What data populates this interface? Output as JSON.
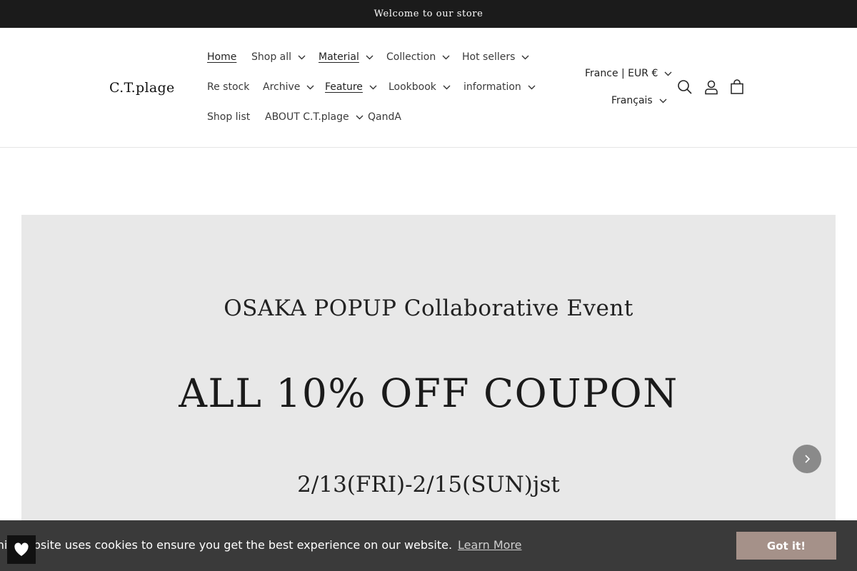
{
  "announcement": "Welcome to our store",
  "logo": "C.T.plage",
  "nav": {
    "row1": [
      {
        "label": "Home",
        "underline": true,
        "dropdown": false
      },
      {
        "label": "Shop all",
        "underline": false,
        "dropdown": true
      },
      {
        "label": "Material",
        "underline": true,
        "dropdown": true
      },
      {
        "label": "Collection",
        "underline": false,
        "dropdown": true
      },
      {
        "label": "Hot sellers",
        "underline": false,
        "dropdown": true
      }
    ],
    "row2": [
      {
        "label": "Re stock",
        "underline": false,
        "dropdown": false
      },
      {
        "label": "Archive",
        "underline": false,
        "dropdown": true
      },
      {
        "label": "Feature",
        "underline": true,
        "dropdown": true
      },
      {
        "label": "Lookbook",
        "underline": false,
        "dropdown": true
      },
      {
        "label": "information",
        "underline": false,
        "dropdown": true
      }
    ],
    "row3": [
      {
        "label": "Shop list",
        "underline": false,
        "dropdown": false
      },
      {
        "label": "ABOUT C.T.plage",
        "underline": false,
        "dropdown": true
      },
      {
        "label": "QandA",
        "underline": false,
        "dropdown": false
      }
    ]
  },
  "localization": {
    "country_currency": "France | EUR €",
    "language": "Français"
  },
  "icons": {
    "search": "search-icon",
    "account": "user-icon",
    "cart": "cart-icon",
    "next": "chevron-right-icon",
    "wishlist": "heart-icon"
  },
  "banner": {
    "line1": "OSAKA POPUP Collaborative Event",
    "line2": "ALL 10% OFF COUPON",
    "line3": "2/13(FRI)-2/15(SUN)jst"
  },
  "cookie": {
    "message": "This website uses cookies to ensure you get the best experience on our website.",
    "learn_more": "Learn More",
    "button": "Got it!"
  },
  "colors": {
    "announcement_bg": "#1b1b1b",
    "banner_bg": "#e8e8e8",
    "cookie_bg": "#3a3a3a",
    "cookie_button": "#a59189"
  }
}
